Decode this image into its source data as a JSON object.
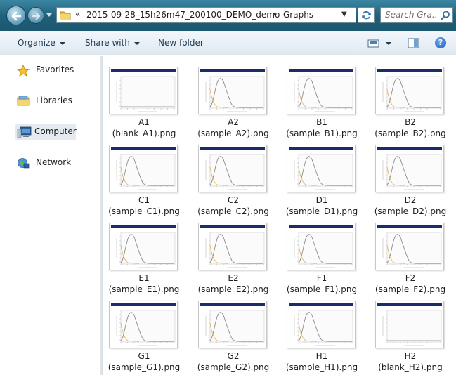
{
  "address_bar": {
    "overflow_glyph": "«",
    "crumbs": [
      "2015-09-28_15h26m47_200100_DEMO_demo",
      "Graphs"
    ],
    "separator": "▸",
    "search_placeholder": "Search Gra..."
  },
  "command_bar": {
    "organize": "Organize",
    "share_with": "Share with",
    "new_folder": "New folder",
    "help": "?"
  },
  "nav_pane": {
    "items": [
      {
        "label": "Favorites",
        "icon": "star-icon"
      },
      {
        "label": "Libraries",
        "icon": "libraries-icon"
      },
      {
        "label": "Computer",
        "icon": "computer-icon"
      },
      {
        "label": "Network",
        "icon": "network-icon"
      }
    ]
  },
  "files": [
    {
      "name": "A1",
      "sub": "(blank_A1).png",
      "kind": "blank"
    },
    {
      "name": "A2",
      "sub": "(sample_A2).png",
      "kind": "sample"
    },
    {
      "name": "B1",
      "sub": "(sample_B1).png",
      "kind": "sample"
    },
    {
      "name": "B2",
      "sub": "(sample_B2).png",
      "kind": "sample"
    },
    {
      "name": "C1",
      "sub": "(sample_C1).png",
      "kind": "sample"
    },
    {
      "name": "C2",
      "sub": "(sample_C2).png",
      "kind": "sample"
    },
    {
      "name": "D1",
      "sub": "(sample_D1).png",
      "kind": "sample"
    },
    {
      "name": "D2",
      "sub": "(sample_D2).png",
      "kind": "sample"
    },
    {
      "name": "E1",
      "sub": "(sample_E1).png",
      "kind": "sample"
    },
    {
      "name": "E2",
      "sub": "(sample_E2).png",
      "kind": "sample"
    },
    {
      "name": "F1",
      "sub": "(sample_F1).png",
      "kind": "sample"
    },
    {
      "name": "F2",
      "sub": "(sample_F2).png",
      "kind": "sample"
    },
    {
      "name": "G1",
      "sub": "(sample_G1).png",
      "kind": "sample"
    },
    {
      "name": "G2",
      "sub": "(sample_G2).png",
      "kind": "sample"
    },
    {
      "name": "H1",
      "sub": "(sample_H1).png",
      "kind": "sample"
    },
    {
      "name": "H2",
      "sub": "(blank_H2).png",
      "kind": "blank"
    }
  ],
  "colors": {
    "title_bar": "#1f5f78",
    "thumb_header": "#1c2c6a",
    "curve_gray": "#8a8a8a",
    "curve_orange": "#e8b860"
  }
}
